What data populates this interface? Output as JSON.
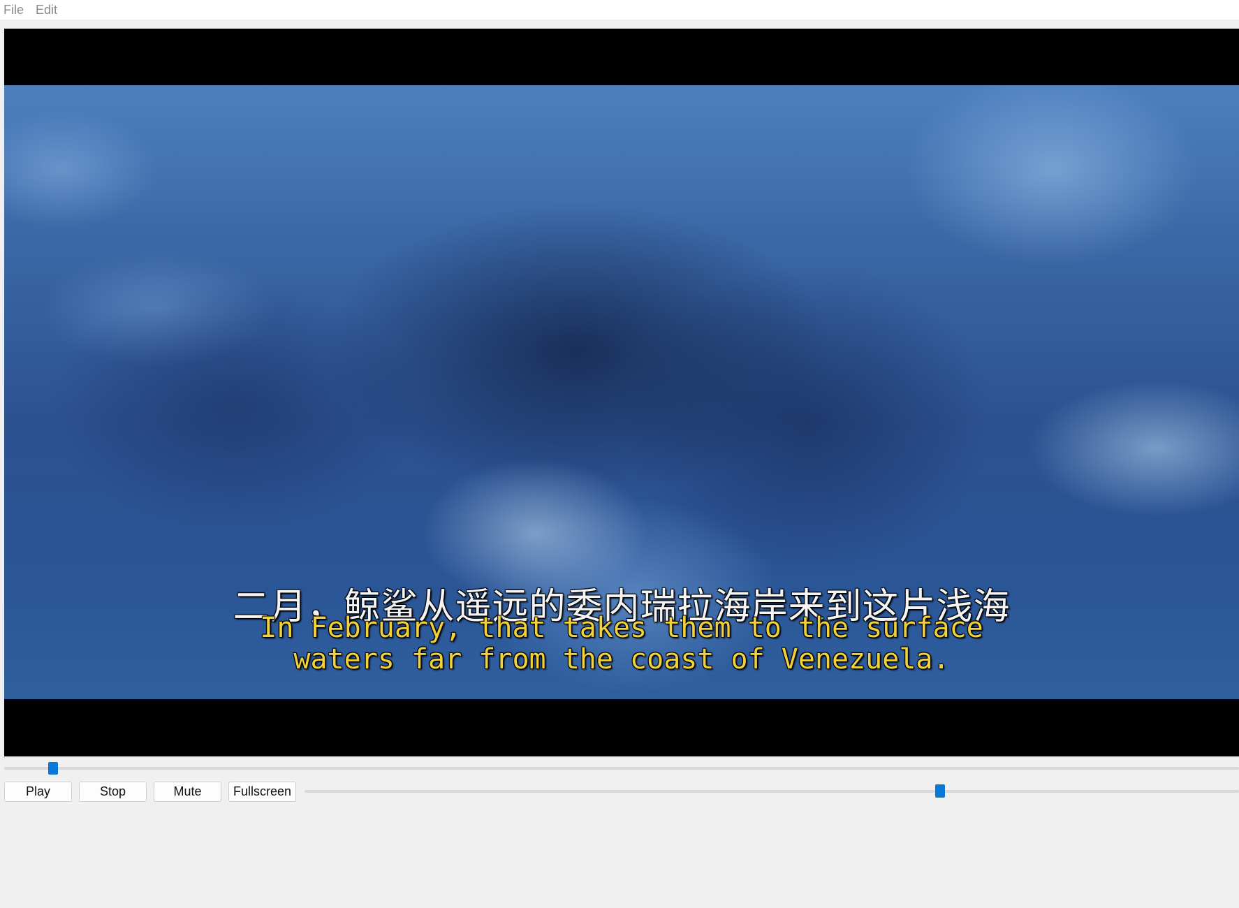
{
  "menu": {
    "items": [
      {
        "label": "File"
      },
      {
        "label": "Edit"
      }
    ]
  },
  "video": {
    "subtitle_zh": "二月，鲸鲨从遥远的委内瑞拉海岸来到这片浅海",
    "subtitle_en_line1": "In February, that takes them to the surface",
    "subtitle_en_line2": "waters far from the coast of Venezuela."
  },
  "controls": {
    "play_label": "Play",
    "stop_label": "Stop",
    "mute_label": "Mute",
    "fullscreen_label": "Fullscreen"
  },
  "seek": {
    "progress_fraction": 0.04
  },
  "volume": {
    "level_fraction": 0.68
  },
  "colors": {
    "accent": "#0a78d7",
    "subtitle_en": "#f2d23a"
  }
}
